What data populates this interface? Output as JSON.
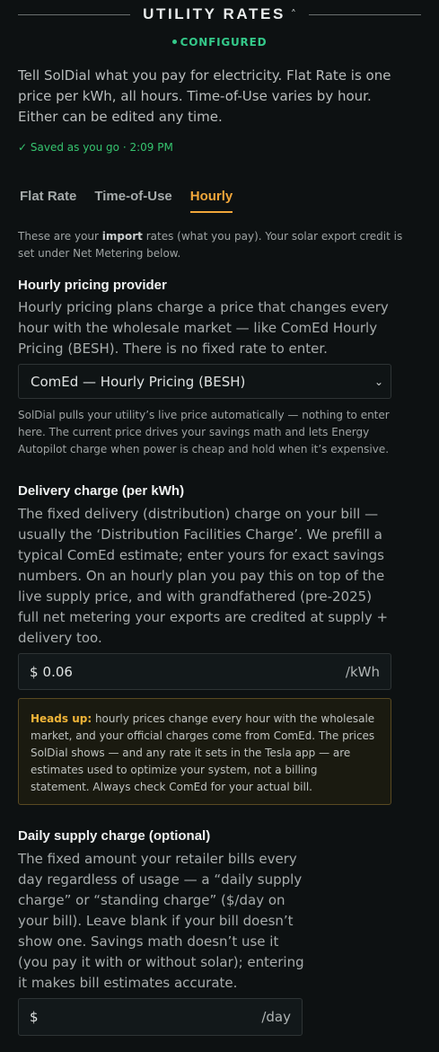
{
  "section": {
    "title": "UTILITY RATES"
  },
  "status": {
    "label": "CONFIGURED"
  },
  "intro": "Tell SolDial what you pay for electricity. Flat Rate is one price per kWh, all hours. Time-of-Use varies by hour. Either can be edited any time.",
  "saved": "Saved as you go · 2:09 PM",
  "tabs": [
    {
      "label": "Flat Rate"
    },
    {
      "label": "Time-of-Use"
    },
    {
      "label": "Hourly"
    }
  ],
  "note": {
    "pre": "These are your ",
    "bold": "import",
    "post": " rates (what you pay). Your solar export credit is set under Net Metering below."
  },
  "provider": {
    "label": "Hourly pricing provider",
    "desc": "Hourly pricing plans charge a price that changes every hour with the wholesale market — like ComEd Hourly Pricing (BESH). There is no fixed rate to enter.",
    "selected": "ComEd — Hourly Pricing (BESH)",
    "help": "SolDial pulls your utility’s live price automatically — nothing to enter here. The current price drives your savings math and lets Energy Autopilot charge when power is cheap and hold when it’s expensive."
  },
  "delivery": {
    "label": "Delivery charge (per kWh)",
    "desc": "The fixed delivery (distribution) charge on your bill — usually the ‘Distribution Facilities Charge’. We prefill a typical ComEd estimate; enter yours for exact savings numbers. On an hourly plan you pay this on top of the live supply price, and with grandfathered (pre-2025) full net metering your exports are credited at supply + delivery too.",
    "prefix": "$",
    "value": "0.06",
    "unit": "/kWh"
  },
  "alert": {
    "bold": "Heads up:",
    "text": " hourly prices change every hour with the wholesale market, and your official charges come from ComEd. The prices SolDial shows — and any rate it sets in the Tesla app — are estimates used to optimize your system, not a billing statement. Always check ComEd for your actual bill."
  },
  "daily": {
    "label": "Daily supply charge (optional)",
    "desc": "The fixed amount your retailer bills every day regardless of usage — a “daily supply charge” or “standing charge” ($/day on your bill). Leave blank if your bill doesn’t show one. Savings math doesn’t use it (you pay it with or without solar); entering it makes bill estimates accurate.",
    "prefix": "$",
    "value": "",
    "unit": "/day"
  },
  "colors": {
    "accent": "#f0a63a",
    "success": "#34c98a",
    "background": "#0d1112"
  }
}
